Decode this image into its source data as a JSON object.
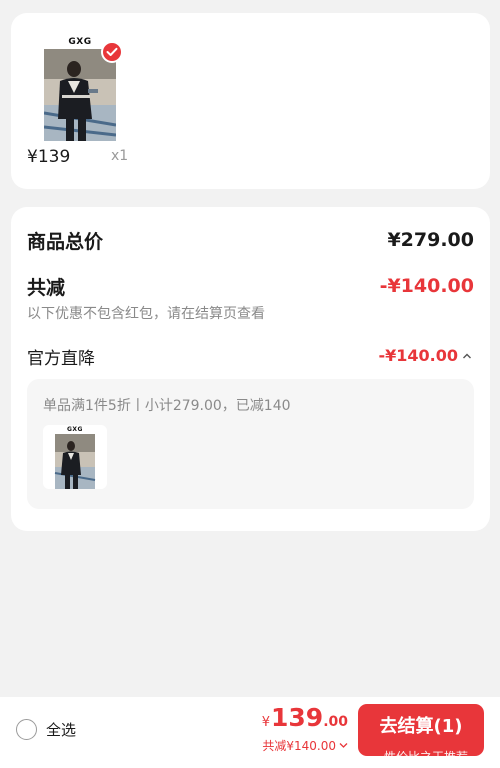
{
  "cart_item": {
    "brand": "GXG",
    "price": "¥139",
    "quantity": "x1",
    "selected": true
  },
  "summary": {
    "total_label": "商品总价",
    "total_value": "¥279.00",
    "discount_label": "共减",
    "discount_value": "-¥140.00",
    "discount_note": "以下优惠不包含红包，请在结算页查看",
    "official_label": "官方直降",
    "official_value": "-¥140.00",
    "promo_desc": "单品满1件5折丨小计279.00，已减140",
    "promo_item_brand": "GXG"
  },
  "bottom_bar": {
    "select_all_label": "全选",
    "currency": "¥",
    "total_int": "139",
    "total_dec": ".00",
    "total_discount": "共减¥140.00",
    "checkout_label": "去结算(1)",
    "watermark": "性价比之王推荐"
  },
  "colors": {
    "accent": "#e8363a",
    "background": "#f2f2f2",
    "card": "#ffffff"
  },
  "icons": [
    "check-icon",
    "chevron-up-icon",
    "chevron-down-icon",
    "radio-icon"
  ]
}
